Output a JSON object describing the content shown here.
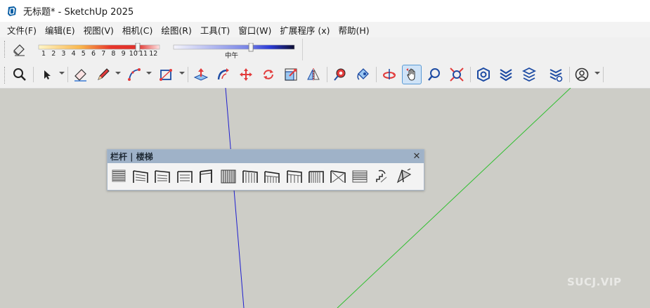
{
  "window": {
    "title": "无标题* - SketchUp 2025"
  },
  "menu": [
    "文件(F)",
    "编辑(E)",
    "视图(V)",
    "相机(C)",
    "绘图(R)",
    "工具(T)",
    "窗口(W)",
    "扩展程序 (x)",
    "帮助(H)"
  ],
  "shadows": {
    "month_ticks": [
      "1",
      "2",
      "3",
      "4",
      "5",
      "6",
      "7",
      "8",
      "9",
      "10",
      "11",
      "12"
    ],
    "time_label": "中午",
    "date_level": 0.82,
    "time_level": 0.64
  },
  "toolbar": {
    "icons": [
      "zoom-icon",
      "select-icon",
      "eraser-icon",
      "pencil-icon",
      "arc-icon",
      "rectangle-icon",
      "push-pull-icon",
      "follow-me-icon",
      "move-icon",
      "rotate-icon",
      "scale-icon",
      "flip-icon",
      "tape-measure-icon",
      "paint-bucket-icon",
      "orbit-icon",
      "pan-icon",
      "zoom-tool-icon",
      "zoom-extents-icon",
      "3d-warehouse-icon",
      "extension-warehouse-icon",
      "layout-icon",
      "extension-manager-icon",
      "account-icon"
    ],
    "active": "pan-icon"
  },
  "railing_window": {
    "title": "栏杆 | 楼梯",
    "close_glyph": "✕",
    "tools": [
      "railing-1",
      "railing-2",
      "railing-3",
      "railing-4",
      "railing-5",
      "railing-6",
      "railing-7",
      "railing-8",
      "railing-9",
      "railing-10",
      "railing-11",
      "railing-12",
      "stair-1",
      "stair-2"
    ]
  },
  "watermark": "SUCJ.VIP",
  "colors": {
    "blue_axis": "#1f1fd0",
    "green_axis": "#2fbf2f",
    "background": "#cdcdc7",
    "accent": "#5b9bd5"
  }
}
